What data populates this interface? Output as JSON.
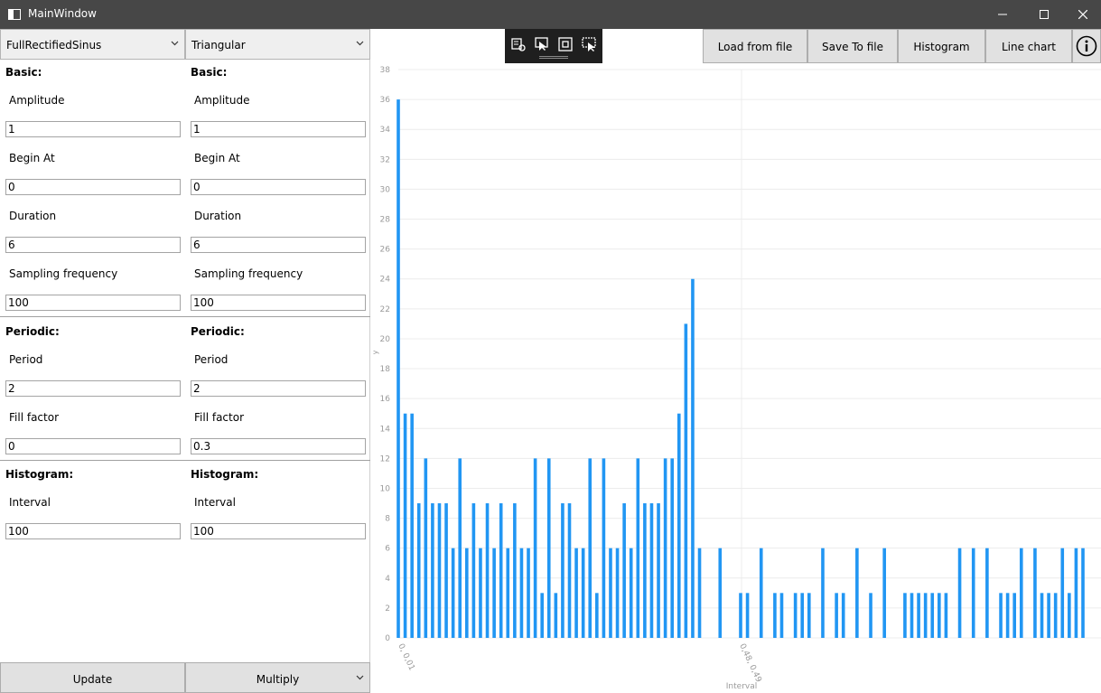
{
  "window": {
    "title": "MainWindow",
    "accent": "#474747"
  },
  "left": {
    "signal_left": "FullRectifiedSinus",
    "signal_right": "Triangular",
    "columns": [
      {
        "basic_header": "Basic:",
        "amplitude_label": "Amplitude",
        "amplitude": "1",
        "begin_label": "Begin At",
        "begin": "0",
        "duration_label": "Duration",
        "duration": "6",
        "freq_label": "Sampling frequency",
        "freq": "100",
        "periodic_header": "Periodic:",
        "period_label": "Period",
        "period": "2",
        "fill_label": "Fill factor",
        "fill": "0",
        "hist_header": "Histogram:",
        "interval_label": "Interval",
        "interval": "100"
      },
      {
        "basic_header": "Basic:",
        "amplitude_label": "Amplitude",
        "amplitude": "1",
        "begin_label": "Begin At",
        "begin": "0",
        "duration_label": "Duration",
        "duration": "6",
        "freq_label": "Sampling frequency",
        "freq": "100",
        "periodic_header": "Periodic:",
        "period_label": "Period",
        "period": "2",
        "fill_label": "Fill factor",
        "fill": "0.3",
        "hist_header": "Histogram:",
        "interval_label": "Interval",
        "interval": "100"
      }
    ],
    "update_label": "Update",
    "operation_label": "Multiply"
  },
  "toolbar": {
    "load_label": "Load from file",
    "save_label": "Save To file",
    "histogram_label": "Histogram",
    "line_chart_label": "Line chart",
    "info_icon": "info-icon"
  },
  "chart_data": {
    "type": "bar",
    "bar_color": "#2196f3",
    "ylabel": "y",
    "xlabel": "Interval",
    "ylim": [
      0,
      38
    ],
    "yticks": [
      0,
      2,
      4,
      6,
      8,
      10,
      12,
      14,
      16,
      18,
      20,
      22,
      24,
      26,
      28,
      30,
      32,
      34,
      36,
      38
    ],
    "x_tick_labels": [
      "0, 0,01",
      "0,48, 0,49"
    ],
    "values": [
      36,
      15,
      15,
      9,
      12,
      9,
      9,
      9,
      6,
      12,
      6,
      9,
      6,
      9,
      6,
      9,
      6,
      9,
      6,
      6,
      12,
      3,
      12,
      3,
      9,
      9,
      6,
      6,
      12,
      3,
      12,
      6,
      6,
      9,
      6,
      12,
      9,
      9,
      9,
      12,
      12,
      15,
      21,
      24,
      6,
      0,
      0,
      6,
      0,
      0,
      3,
      3,
      0,
      6,
      0,
      3,
      3,
      0,
      3,
      3,
      3,
      0,
      6,
      0,
      3,
      3,
      0,
      6,
      0,
      3,
      0,
      6,
      0,
      0,
      3,
      3,
      3,
      3,
      3,
      3,
      3,
      0,
      6,
      0,
      6,
      0,
      6,
      0,
      3,
      3,
      3,
      6,
      0,
      6,
      3,
      3,
      3,
      6,
      3,
      6,
      6
    ]
  }
}
